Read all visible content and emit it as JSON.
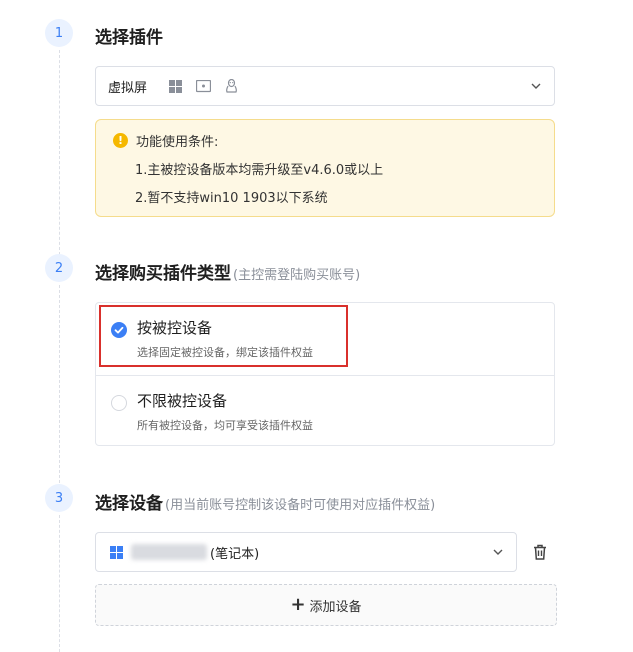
{
  "steps": [
    {
      "number": "1",
      "title": "选择插件",
      "hint": ""
    },
    {
      "number": "2",
      "title": "选择购买插件类型",
      "hint": "(主控需登陆购买账号)"
    },
    {
      "number": "3",
      "title": "选择设备",
      "hint": "(用当前账号控制该设备时可使用对应插件权益)"
    }
  ],
  "plugin_select": {
    "value": "虚拟屏",
    "os_icons": [
      "windows-icon",
      "monitor-icon",
      "linux-icon"
    ]
  },
  "notice": {
    "title": "功能使用条件:",
    "lines": [
      "1.主被控设备版本均需升级至v4.6.0或以上",
      "2.暂不支持win10 1903以下系统"
    ]
  },
  "purchase_types": [
    {
      "label": "按被控设备",
      "description": "选择固定被控设备，绑定该插件权益",
      "selected": true
    },
    {
      "label": "不限被控设备",
      "description": "所有被控设备，均可享受该插件权益",
      "selected": false
    }
  ],
  "device_select": {
    "suffix": "(笔记本)",
    "os_icon": "windows-icon"
  },
  "add_device_label": "添加设备",
  "colors": {
    "accent": "#3b7ff5",
    "warning": "#f5b800",
    "notice_bg": "#fef8e4",
    "highlight_border": "#d9302c"
  }
}
